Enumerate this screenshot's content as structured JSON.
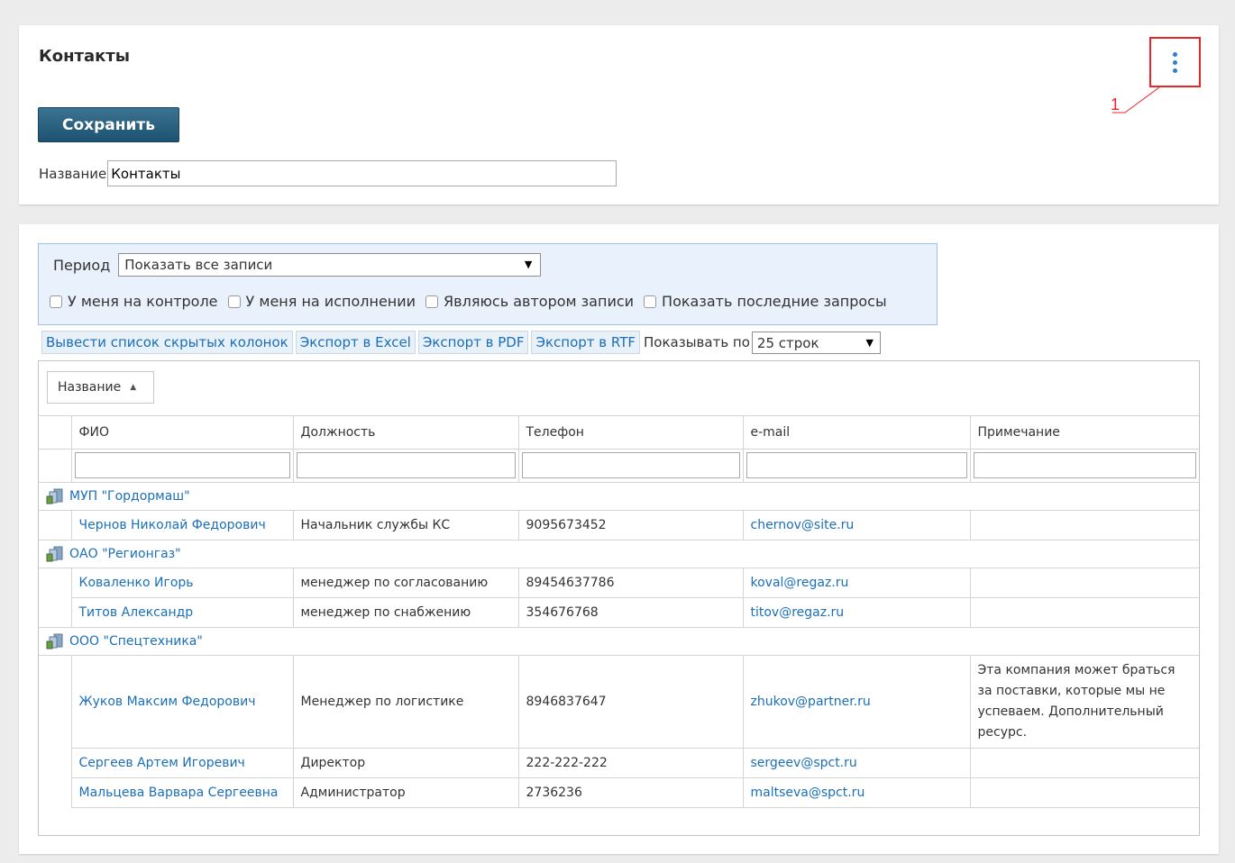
{
  "page": {
    "title": "Контакты",
    "save_label": "Сохранить",
    "name_label": "Название",
    "name_value": "Контакты",
    "annotation_number": "1"
  },
  "filters": {
    "period_label": "Период",
    "period_value": "Показать все записи",
    "checkboxes": [
      {
        "label": "У меня на контроле",
        "checked": false
      },
      {
        "label": "У меня на исполнении",
        "checked": false
      },
      {
        "label": "Являюсь автором записи",
        "checked": false
      },
      {
        "label": "Показать последние запросы",
        "checked": false
      }
    ]
  },
  "toolbar": {
    "hidden_cols": "Вывести список скрытых колонок",
    "export_excel": "Экспорт в Excel",
    "export_pdf": "Экспорт в PDF",
    "export_rtf": "Экспорт в RTF",
    "show_by_label": "Показывать по",
    "rows_value": "25 строк"
  },
  "grid": {
    "group_by_label": "Название",
    "columns": [
      "ФИО",
      "Должность",
      "Телефон",
      "e-mail",
      "Примечание"
    ],
    "groups": [
      {
        "name": "МУП \"Гордормаш\"",
        "rows": [
          {
            "fio": "Чернов Николай Федорович",
            "position": "Начальник службы КС",
            "phone": "9095673452",
            "email": "chernov@site.ru",
            "note": ""
          }
        ]
      },
      {
        "name": "ОАО \"Регионгаз\"",
        "rows": [
          {
            "fio": "Коваленко Игорь",
            "position": "менеджер по согласованию",
            "phone": "89454637786",
            "email": "koval@regaz.ru",
            "note": ""
          },
          {
            "fio": "Титов Александр",
            "position": "менеджер по снабжению",
            "phone": "354676768",
            "email": "titov@regaz.ru",
            "note": ""
          }
        ]
      },
      {
        "name": "ООО \"Спецтехника\"",
        "rows": [
          {
            "fio": "Жуков Максим Федорович",
            "position": "Менеджер по логистике",
            "phone": "8946837647",
            "email": "zhukov@partner.ru",
            "note": "Эта компания может браться за поставки, которые мы не успеваем. Дополнительный ресурс."
          },
          {
            "fio": "Сергеев Артем Игоревич",
            "position": "Директор",
            "phone": "222-222-222",
            "email": "sergeev@spct.ru",
            "note": ""
          },
          {
            "fio": "Мальцева Варвара Сергеевна",
            "position": "Администратор",
            "phone": "2736236",
            "email": "maltseva@spct.ru",
            "note": ""
          }
        ]
      }
    ]
  }
}
